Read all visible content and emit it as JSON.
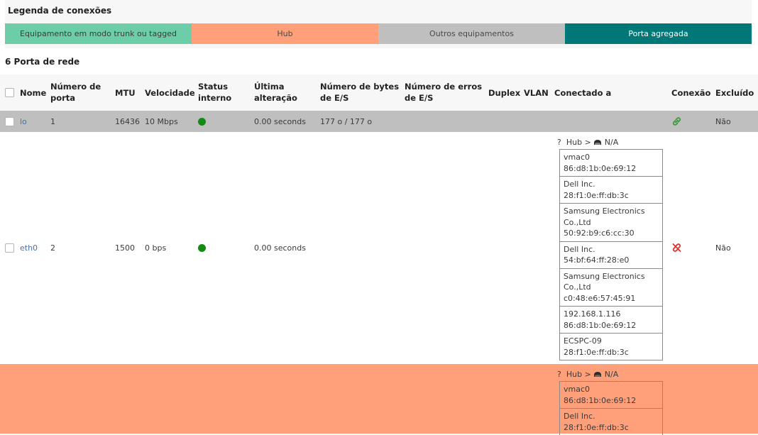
{
  "legend": {
    "title": "Legenda de conexões",
    "items": [
      {
        "label": "Equipamento em modo trunk ou tagged",
        "color": "#6ccda8"
      },
      {
        "label": "Hub",
        "color": "#ffa07a"
      },
      {
        "label": "Outros equipamentos",
        "color": "#bfbfbf"
      },
      {
        "label": "Porta agregada",
        "color": "#007878"
      }
    ]
  },
  "ports": {
    "title": "6 Porta de rede",
    "columns": {
      "nome": "Nome",
      "numero_porta_1": "Número de",
      "numero_porta_2": "porta",
      "mtu": "MTU",
      "velocidade": "Velocidade",
      "status_1": "Status",
      "status_2": "interno",
      "ultima_1": "Última",
      "ultima_2": "alteração",
      "bytes_1": "Número de bytes",
      "bytes_2": "de E/S",
      "erros_1": "Número de erros",
      "erros_2": "de E/S",
      "duplex": "Duplex",
      "vlan": "VLAN",
      "conectado": "Conectado a",
      "conexao": "Conexão",
      "excluido": "Excluído"
    },
    "rows": [
      {
        "name": "lo",
        "port": "1",
        "mtu": "16436",
        "speed": "10 Mbps",
        "status_color": "#138a13",
        "last_change": "0.00 seconds",
        "bytes": "177 o / 177 o",
        "connection_icon": "link-icon",
        "connection_color": "#3c9a3c",
        "excluded": "Não"
      },
      {
        "name": "eth0",
        "port": "2",
        "mtu": "1500",
        "speed": "0 bps",
        "status_color": "#138a13",
        "last_change": "0.00 seconds",
        "connected": {
          "prefix": "?",
          "hub": "Hub >",
          "hub_value": "N/A",
          "devices": [
            [
              "vmac0",
              "86:d8:1b:0e:69:12"
            ],
            [
              "Dell Inc.",
              "28:f1:0e:ff:db:3c"
            ],
            [
              "Samsung Electronics",
              "Co.,Ltd",
              "50:92:b9:c6:cc:30"
            ],
            [
              "Dell Inc.",
              "54:bf:64:ff:28:e0"
            ],
            [
              "Samsung Electronics",
              "Co.,Ltd",
              "c0:48:e6:57:45:91"
            ],
            [
              "192.168.1.116",
              "86:d8:1b:0e:69:12"
            ],
            [
              "ECSPC-09",
              "28:f1:0e:ff:db:3c"
            ]
          ]
        },
        "connection_icon": "broken-link-icon",
        "connection_color": "#e03030",
        "excluded": "Não"
      },
      {
        "connected": {
          "prefix": "?",
          "hub": "Hub >",
          "hub_value": "N/A",
          "devices": [
            [
              "vmac0",
              "86:d8:1b:0e:69:12"
            ],
            [
              "Dell Inc.",
              "28:f1:0e:ff:db:3c"
            ]
          ]
        }
      }
    ]
  }
}
